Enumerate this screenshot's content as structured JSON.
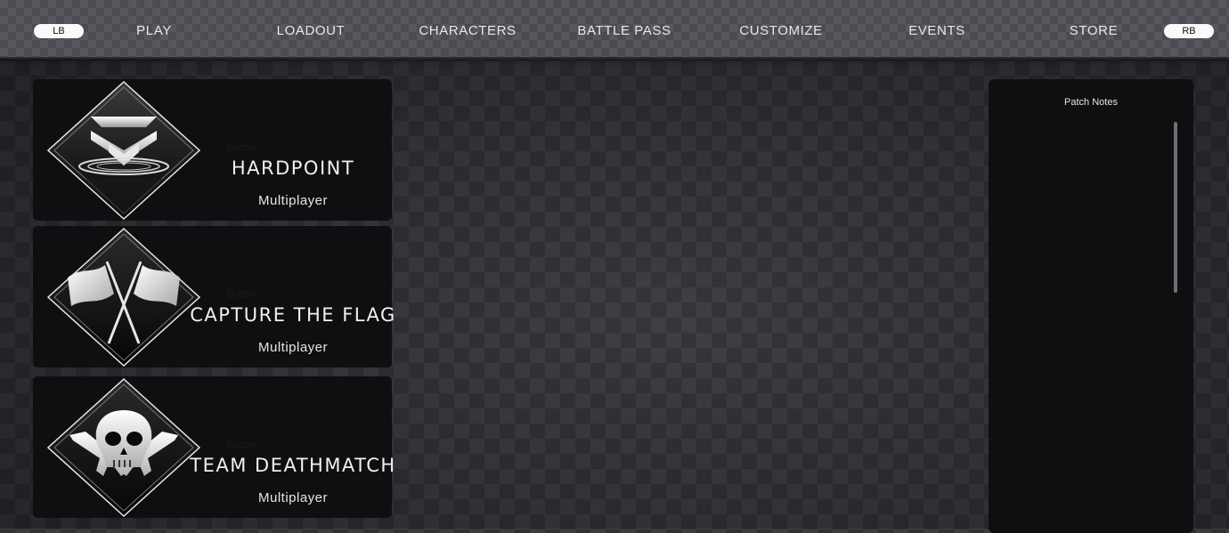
{
  "nav": {
    "left_bumper": "LB",
    "right_bumper": "RB",
    "items": [
      {
        "label": "PLAY"
      },
      {
        "label": "LOADOUT"
      },
      {
        "label": "CHARACTERS"
      },
      {
        "label": "BATTLE PASS"
      },
      {
        "label": "CUSTOMIZE"
      },
      {
        "label": "EVENTS"
      },
      {
        "label": "STORE"
      }
    ]
  },
  "modes": [
    {
      "title": "HARDPOINT",
      "subtitle": "Multiplayer",
      "ghost_label": "Button",
      "icon": "hardpoint-icon"
    },
    {
      "title": "CAPTURE THE FLAG",
      "subtitle": "Multiplayer",
      "ghost_label": "Button",
      "icon": "crossed-flags-icon"
    },
    {
      "title": "TEAM DEATHMATCH",
      "subtitle": "Multiplayer",
      "ghost_label": "Button",
      "icon": "skull-guns-icon"
    }
  ],
  "patch_notes": {
    "title": "Patch Notes"
  },
  "colors": {
    "card_bg": "#0e0f10",
    "nav_text": "#e8e8e8",
    "accent_white": "#ffffff"
  }
}
